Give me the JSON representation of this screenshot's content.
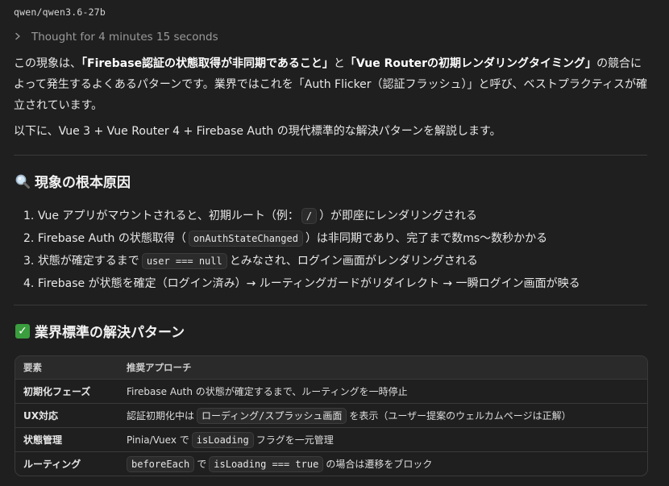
{
  "header": {
    "model_name": "qwen/qwen3.6-27b",
    "thought_label": "Thought for 4 minutes 15 seconds"
  },
  "intro": {
    "p1_a": "この現象は、",
    "p1_b": "「Firebase認証の状態取得が非同期であること」",
    "p1_c": "と",
    "p1_d": "「Vue Routerの初期レンダリングタイミング」",
    "p1_e": "の競合によって発生するよくあるパターンです。業界ではこれを「Auth Flicker（認証フラッシュ）」と呼び、ベストプラクティスが確立されています。",
    "p2": "以下に、Vue 3 + Vue Router 4 + Firebase Auth の現代標準的な解決パターンを解説します。"
  },
  "section1": {
    "icon": "magnifier-icon",
    "title": "現象の根本原因",
    "items": [
      {
        "num": "1.",
        "a": "Vue アプリがマウントされると、初期ルート（例：",
        "code": "/",
        "b": "）が即座にレンダリングされる"
      },
      {
        "num": "2.",
        "a": "Firebase Auth の状態取得（",
        "code": "onAuthStateChanged",
        "b": "）は非同期であり、完了まで数ms〜数秒かかる"
      },
      {
        "num": "3.",
        "a": "状態が確定するまで",
        "code": "user === null",
        "b": "とみなされ、ログイン画面がレンダリングされる"
      },
      {
        "num": "4.",
        "a": "Firebase が状態を確定（ログイン済み）→ ルーティングガードがリダイレクト → 一瞬ログイン画面が映る",
        "code": "",
        "b": ""
      }
    ]
  },
  "section2": {
    "icon": "check-icon",
    "title": "業界標準の解決パターン",
    "table": {
      "headers": [
        "要素",
        "推奨アプローチ"
      ],
      "rows": [
        {
          "key": "初期化フェーズ",
          "pre": "Firebase Auth の状態が確定するまで、ルーティングを一時停止",
          "code1": "",
          "mid": "",
          "code2": "",
          "post": ""
        },
        {
          "key": "UX対応",
          "pre": "認証初期化中は",
          "code1": "ローディング/スプラッシュ画面",
          "mid": "を表示（ユーザー提案のウェルカムページは正解）",
          "code2": "",
          "post": ""
        },
        {
          "key": "状態管理",
          "pre": "Pinia/Vuex で",
          "code1": "isLoading",
          "mid": "フラグを一元管理",
          "code2": "",
          "post": ""
        },
        {
          "key": "ルーティング",
          "pre": "",
          "code1": "beforeEach",
          "mid": "で",
          "code2": "isLoading === true",
          "post": "の場合は遷移をブロック"
        }
      ]
    }
  }
}
